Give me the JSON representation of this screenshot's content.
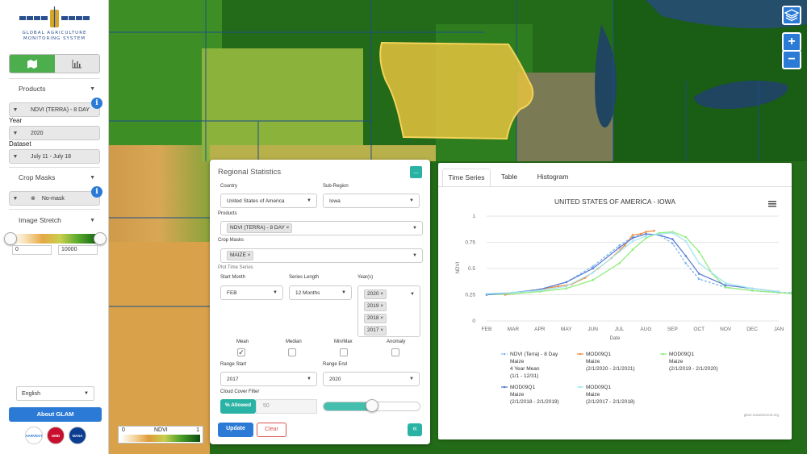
{
  "sidebar": {
    "logo_line1": "GLOBAL AGRICULTURE",
    "logo_line2": "MONITORING SYSTEM",
    "products_header": "Products",
    "product_value": "NDVI (TERRA) - 8 DAY",
    "year_label": "Year",
    "year_value": "2020",
    "dataset_label": "Dataset",
    "dataset_value": "July 11 - July 18",
    "crop_masks_header": "Crop Masks",
    "crop_mask_value": "No-mask",
    "image_stretch_header": "Image Stretch",
    "stretch_min": "0",
    "stretch_max": "10000",
    "language": "English",
    "about_button": "About GLAM",
    "partners": [
      "HARVEST",
      "UMD",
      "NASA"
    ]
  },
  "map": {
    "legend_label": "NDVI",
    "legend_min": "0",
    "legend_max": "1",
    "zoom_in": "+",
    "zoom_out": "−"
  },
  "regional": {
    "title": "Regional Statistics",
    "country_label": "Country",
    "country_value": "United States of America",
    "subregion_label": "Sub-Region",
    "subregion_value": "Iowa",
    "products_label": "Products",
    "products_tag": "NDVI (TERRA) - 8 DAY",
    "cropmasks_label": "Crop Masks",
    "cropmasks_tag": "MAIZE",
    "plot_ts_label": "Plot Time Series",
    "start_month_label": "Start Month",
    "start_month_value": "FEB",
    "series_length_label": "Series Length",
    "series_length_value": "12 Months",
    "years_label": "Year(s)",
    "years": [
      "2020",
      "2019",
      "2018",
      "2017"
    ],
    "stats": [
      {
        "label": "Mean",
        "checked": true
      },
      {
        "label": "Median",
        "checked": false
      },
      {
        "label": "Min/Max",
        "checked": false
      },
      {
        "label": "Anomaly",
        "checked": false
      }
    ],
    "range_start_label": "Range Start",
    "range_start_value": "2017",
    "range_end_label": "Range End",
    "range_end_value": "2020",
    "cloud_label": "Cloud Cover Filter",
    "cloud_button": "% Allowed",
    "cloud_value": "50",
    "cloud_fraction": 0.5,
    "update_button": "Update",
    "clear_button": "Clear",
    "collapse_button": "«"
  },
  "chart_panel": {
    "tabs": [
      "Time Series",
      "Table",
      "Histogram"
    ],
    "active_tab": "Time Series",
    "credit": "glam.nasaharvest.org"
  },
  "chart_data": {
    "type": "line",
    "title": "UNITED STATES OF AMERICA - IOWA",
    "xlabel": "Date",
    "ylabel": "NDVI",
    "ylim": [
      0,
      1
    ],
    "yticks": [
      "0",
      "0.25",
      "0.5",
      "0.75",
      "1"
    ],
    "categories": [
      "FEB",
      "MAR",
      "APR",
      "MAY",
      "JUN",
      "JUL",
      "AUG",
      "SEP",
      "OCT",
      "NOV",
      "DEC",
      "JAN"
    ],
    "grid": true,
    "legend": "bottom",
    "series": [
      {
        "name": "NDVI (Terra) - 8 Day",
        "sub": [
          "Maize",
          "4 Year Mean",
          "(1/1 - 12/31)"
        ],
        "color": "#7cb5ec",
        "dash": true,
        "x": [
          0,
          1,
          2,
          3,
          4,
          5,
          5.5,
          6,
          6.5,
          7,
          7.5,
          8,
          9,
          10,
          11,
          11.5
        ],
        "values": [
          0.26,
          0.27,
          0.3,
          0.37,
          0.52,
          0.72,
          0.8,
          0.83,
          0.82,
          0.74,
          0.55,
          0.4,
          0.32,
          0.29,
          0.27,
          0.27
        ]
      },
      {
        "name": "MOD09Q1",
        "sub": [
          "Maize",
          "(2/1/2020 - 2/1/2021)"
        ],
        "color": "#f28f43",
        "dash": false,
        "x": [
          0.7,
          1.2,
          1.7,
          2.2,
          2.7,
          3.2,
          3.7,
          4.2,
          4.7,
          5.2,
          5.5,
          5.8,
          6.0,
          6.3
        ],
        "values": [
          0.25,
          0.27,
          0.29,
          0.31,
          0.33,
          0.35,
          0.41,
          0.5,
          0.6,
          0.72,
          0.82,
          0.83,
          0.85,
          0.86
        ]
      },
      {
        "name": "MOD09Q1",
        "sub": [
          "Maize",
          "(2/1/2019 - 2/1/2020)"
        ],
        "color": "#90ed7d",
        "dash": false,
        "x": [
          0,
          1,
          2,
          3,
          4,
          5,
          5.5,
          6,
          6.5,
          7,
          7.5,
          8,
          8.5,
          9,
          10,
          11,
          11.5
        ],
        "values": [
          0.25,
          0.26,
          0.28,
          0.31,
          0.39,
          0.55,
          0.68,
          0.79,
          0.84,
          0.85,
          0.8,
          0.66,
          0.45,
          0.32,
          0.29,
          0.27,
          0.26
        ]
      },
      {
        "name": "MOD09Q1",
        "sub": [
          "Maize",
          "(2/1/2018 - 2/1/2019)"
        ],
        "color": "#5b7fd6",
        "dash": false,
        "x": [
          0,
          1,
          2,
          3,
          4,
          5,
          5.5,
          6,
          6.5,
          7,
          7.5,
          8,
          9,
          10,
          11
        ],
        "values": [
          0.25,
          0.27,
          0.3,
          0.37,
          0.5,
          0.7,
          0.79,
          0.83,
          0.82,
          0.78,
          0.62,
          0.45,
          0.34,
          0.31,
          0.28
        ]
      },
      {
        "name": "MOD09Q1",
        "sub": [
          "Maize",
          "(2/1/2017 - 2/1/2018)"
        ],
        "color": "#a8e6f0",
        "dash": false,
        "x": [
          0,
          1,
          2,
          3,
          4,
          5,
          5.5,
          6,
          6.5,
          7,
          7.5,
          8,
          9,
          10,
          11
        ],
        "values": [
          0.26,
          0.27,
          0.29,
          0.33,
          0.46,
          0.66,
          0.76,
          0.81,
          0.83,
          0.84,
          0.76,
          0.55,
          0.36,
          0.31,
          0.28
        ]
      }
    ]
  }
}
